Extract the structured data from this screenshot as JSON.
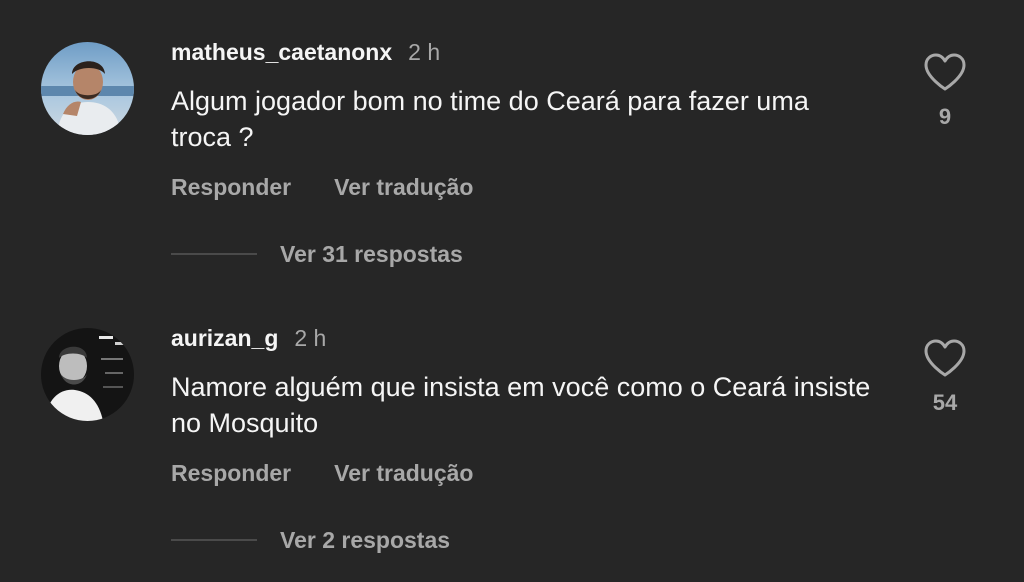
{
  "comments": [
    {
      "username": "matheus_caetanonx",
      "time": "2 h",
      "text": "Algum jogador bom no time do Ceará para fazer uma troca ?",
      "reply_label": "Responder",
      "translate_label": "Ver tradução",
      "view_replies_label": "Ver 31 respostas",
      "likes": "9"
    },
    {
      "username": "aurizan_g",
      "time": "2 h",
      "text": "Namore alguém que insista em você como o Ceará insiste no Mosquito",
      "reply_label": "Responder",
      "translate_label": "Ver tradução",
      "view_replies_label": "Ver 2 respostas",
      "likes": "54"
    }
  ],
  "icons": {
    "like": "heart-outline-icon"
  },
  "colors": {
    "background": "#262626",
    "primary_text": "#f5f5f5",
    "secondary_text": "#a8a8a8"
  }
}
